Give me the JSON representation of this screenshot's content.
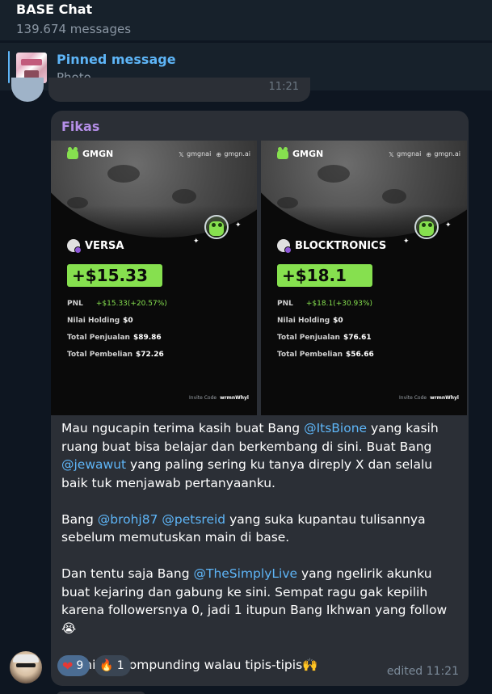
{
  "header": {
    "title": "BASE Chat",
    "subtitle": "139.674 messages"
  },
  "pinned": {
    "title": "Pinned message",
    "subtitle": "Photo"
  },
  "previous_message": {
    "time": "11:21"
  },
  "message": {
    "sender": "Fikas",
    "sender_color": "#b58fe8",
    "cards": [
      {
        "brand": "GMGN",
        "social_x": "gmgnai",
        "social_web": "gmgn.ai",
        "token": "VERSA",
        "pnl_big": "+$15.33",
        "stats": [
          {
            "label": "PNL",
            "value": "+$15.33(+20.57%)"
          },
          {
            "label": "Nilai Holding",
            "value": "$0"
          },
          {
            "label": "Total Penjualan",
            "value": "$89.86"
          },
          {
            "label": "Total Pembelian",
            "value": "$72.26"
          }
        ],
        "invite_label": "Invite Code",
        "invite_code": "wrmnWhyl"
      },
      {
        "brand": "GMGN",
        "social_x": "gmgnai",
        "social_web": "gmgn.ai",
        "token": "BLOCKTRONICS",
        "pnl_big": "+$18.1",
        "stats": [
          {
            "label": "PNL",
            "value": "+$18.1(+30.93%)"
          },
          {
            "label": "Nilai Holding",
            "value": "$0"
          },
          {
            "label": "Total Penjualan",
            "value": "$76.61"
          },
          {
            "label": "Total Pembelian",
            "value": "$56.66"
          }
        ],
        "invite_label": "Invite Code",
        "invite_code": "wrmnWhyl"
      }
    ],
    "caption": {
      "p1_a": "Mau ngucapin terima kasih buat Bang ",
      "p1_m1": "@ItsBione",
      "p1_b": " yang kasih ruang buat bisa belajar dan berkembang di sini. Buat Bang ",
      "p1_m2": "@jewawut",
      "p1_c": " yang paling sering ku tanya direply X dan selalu baik tuk menjawab pertanyaanku.",
      "p2_a": "Bang ",
      "p2_m1": "@brohj87",
      "p2_sp": " ",
      "p2_m2": "@petsreid",
      "p2_b": " yang suka kupantau tulisannya sebelum memutuskan main di base.",
      "p3_a": "Dan tentu saja Bang ",
      "p3_m1": "@TheSimplyLive",
      "p3_b": " yang ngelirik akunku buat kejaring dan gabung ke sini. Sempat ragu gak kepilih karena followersnya 0, jadi 1 itupun Bang Ikhwan yang follow😭",
      "p4": "Bismillah compunding walau tipis-tipis🙌"
    },
    "reactions": [
      {
        "emoji_icon": "heart-icon",
        "count": "9"
      },
      {
        "emoji_icon": "fire-icon",
        "count": "1"
      }
    ],
    "status": "edited 11:21"
  },
  "colors": {
    "background": "#0e1621",
    "bubble": "#2b2f36",
    "accent": "#5eb5f7",
    "green": "#86e04f"
  }
}
